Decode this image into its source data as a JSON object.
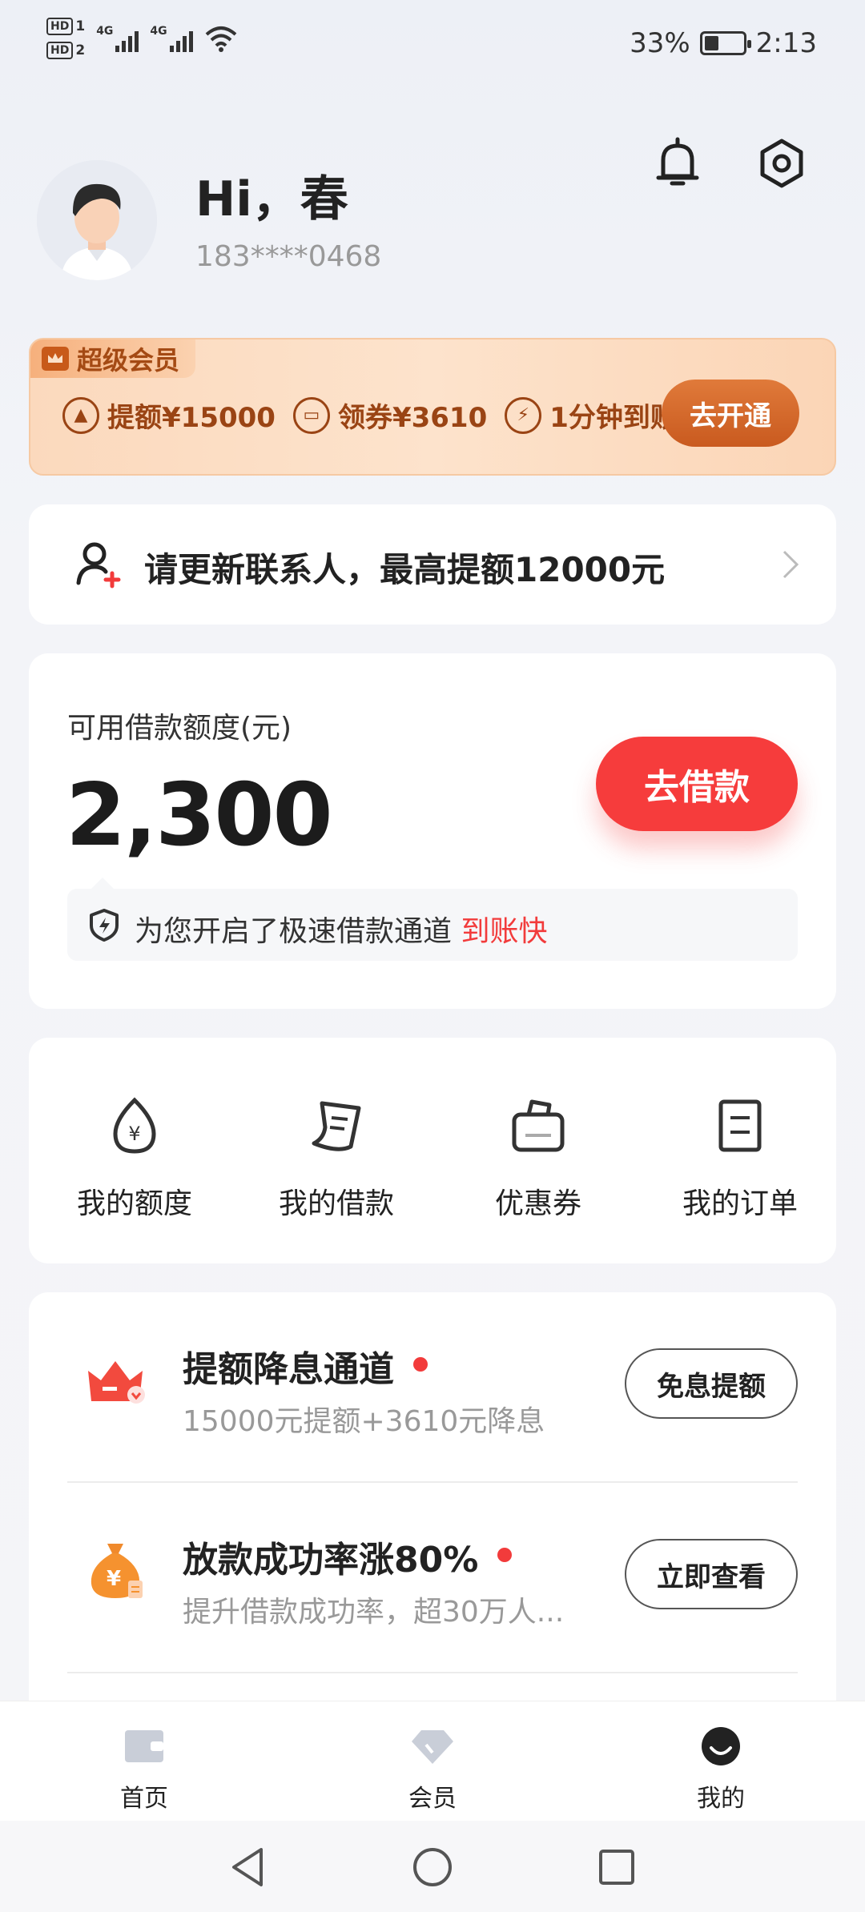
{
  "status_bar": {
    "hd1": "HD",
    "hd1_sim": "1",
    "hd2": "HD",
    "hd2_sim": "2",
    "net1": "4G",
    "net2": "4G",
    "battery_pct": "33%",
    "time": "2:13"
  },
  "header": {
    "greeting": "Hi，春",
    "phone": "183****0468"
  },
  "vip": {
    "tag": "超级会员",
    "perks": [
      {
        "icon": "arrow-up-icon",
        "label": "提额¥15000"
      },
      {
        "icon": "coupon-icon",
        "label": "领券¥3610"
      },
      {
        "icon": "lightning-icon",
        "label": "1分钟到账"
      }
    ],
    "button": "去开通"
  },
  "contact": {
    "text": "请更新联系人，最高提额12000元"
  },
  "loan": {
    "label": "可用借款额度(元)",
    "amount": "2,300",
    "button": "去借款",
    "notice": "为您开启了极速借款通道",
    "notice_highlight": "到账快"
  },
  "shortcuts": [
    {
      "icon": "quota-drop-icon",
      "label": "我的额度"
    },
    {
      "icon": "loan-doc-icon",
      "label": "我的借款"
    },
    {
      "icon": "coupon-bag-icon",
      "label": "优惠券"
    },
    {
      "icon": "order-icon",
      "label": "我的订单"
    }
  ],
  "promos": [
    {
      "icon": "crown-icon",
      "title": "提额降息通道",
      "subtitle": "15000元提额+3610元降息",
      "button": "免息提额"
    },
    {
      "icon": "money-bag-icon",
      "title": "放款成功率涨80%",
      "subtitle": "提升借款成功率，超30万人...",
      "button": "立即查看"
    }
  ],
  "bottom_nav": [
    {
      "icon": "wallet-icon",
      "label": "首页"
    },
    {
      "icon": "diamond-icon",
      "label": "会员"
    },
    {
      "icon": "profile-icon",
      "label": "我的",
      "active": true
    }
  ],
  "colors": {
    "accent_red": "#f63c3c",
    "vip_brown": "#9a4414",
    "vip_button": "#c95a1f"
  }
}
